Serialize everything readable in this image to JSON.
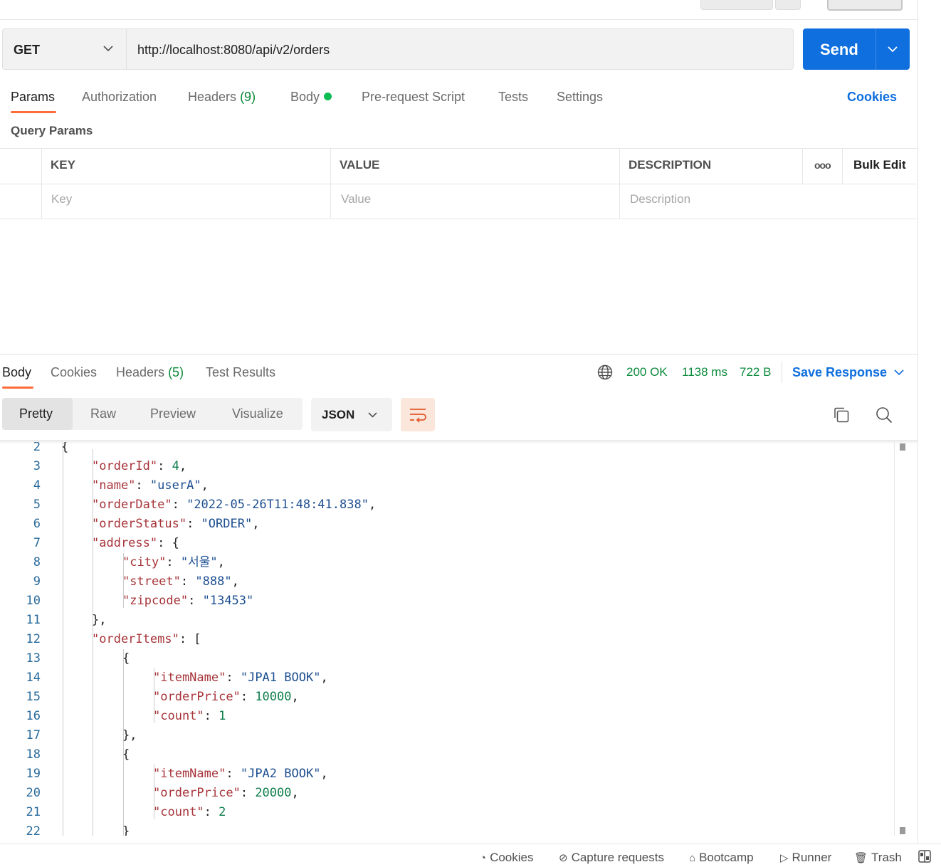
{
  "request": {
    "method": "GET",
    "url": "http://localhost:8080/api/v2/orders",
    "send_label": "Send"
  },
  "request_tabs": [
    {
      "label": "Params",
      "active": true
    },
    {
      "label": "Authorization"
    },
    {
      "label": "Headers",
      "count": "(9)"
    },
    {
      "label": "Body",
      "has_dot": true
    },
    {
      "label": "Pre-request Script"
    },
    {
      "label": "Tests"
    },
    {
      "label": "Settings"
    }
  ],
  "cookies_link": "Cookies",
  "query_params": {
    "title": "Query Params",
    "columns": {
      "key": "KEY",
      "value": "VALUE",
      "description": "DESCRIPTION"
    },
    "more_icon": "ooo",
    "bulk_edit": "Bulk Edit",
    "placeholders": {
      "key": "Key",
      "value": "Value",
      "description": "Description"
    }
  },
  "response": {
    "tabs": [
      {
        "label": "Body",
        "active": true
      },
      {
        "label": "Cookies"
      },
      {
        "label": "Headers",
        "count": "(5)"
      },
      {
        "label": "Test Results"
      }
    ],
    "status": "200 OK",
    "time": "1138 ms",
    "size": "722 B",
    "save_response": "Save Response",
    "view_modes": [
      "Pretty",
      "Raw",
      "Preview",
      "Visualize"
    ],
    "active_view": "Pretty",
    "format": "JSON"
  },
  "code_lines": [
    {
      "n": "2",
      "indent": 1,
      "tokens": [
        {
          "t": "{",
          "c": "p"
        }
      ]
    },
    {
      "n": "3",
      "indent": 2,
      "tokens": [
        {
          "t": "\"orderId\"",
          "c": "k"
        },
        {
          "t": ": ",
          "c": "p"
        },
        {
          "t": "4",
          "c": "n"
        },
        {
          "t": ",",
          "c": "p"
        }
      ]
    },
    {
      "n": "4",
      "indent": 2,
      "tokens": [
        {
          "t": "\"name\"",
          "c": "k"
        },
        {
          "t": ": ",
          "c": "p"
        },
        {
          "t": "\"userA\"",
          "c": "s"
        },
        {
          "t": ",",
          "c": "p"
        }
      ]
    },
    {
      "n": "5",
      "indent": 2,
      "tokens": [
        {
          "t": "\"orderDate\"",
          "c": "k"
        },
        {
          "t": ": ",
          "c": "p"
        },
        {
          "t": "\"2022-05-26T11:48:41.838\"",
          "c": "s"
        },
        {
          "t": ",",
          "c": "p"
        }
      ]
    },
    {
      "n": "6",
      "indent": 2,
      "tokens": [
        {
          "t": "\"orderStatus\"",
          "c": "k"
        },
        {
          "t": ": ",
          "c": "p"
        },
        {
          "t": "\"ORDER\"",
          "c": "s"
        },
        {
          "t": ",",
          "c": "p"
        }
      ]
    },
    {
      "n": "7",
      "indent": 2,
      "tokens": [
        {
          "t": "\"address\"",
          "c": "k"
        },
        {
          "t": ": {",
          "c": "p"
        }
      ]
    },
    {
      "n": "8",
      "indent": 3,
      "tokens": [
        {
          "t": "\"city\"",
          "c": "k"
        },
        {
          "t": ": ",
          "c": "p"
        },
        {
          "t": "\"서울\"",
          "c": "s"
        },
        {
          "t": ",",
          "c": "p"
        }
      ]
    },
    {
      "n": "9",
      "indent": 3,
      "tokens": [
        {
          "t": "\"street\"",
          "c": "k"
        },
        {
          "t": ": ",
          "c": "p"
        },
        {
          "t": "\"888\"",
          "c": "s"
        },
        {
          "t": ",",
          "c": "p"
        }
      ]
    },
    {
      "n": "10",
      "indent": 3,
      "tokens": [
        {
          "t": "\"zipcode\"",
          "c": "k"
        },
        {
          "t": ": ",
          "c": "p"
        },
        {
          "t": "\"13453\"",
          "c": "s"
        }
      ]
    },
    {
      "n": "11",
      "indent": 2,
      "tokens": [
        {
          "t": "},",
          "c": "p"
        }
      ]
    },
    {
      "n": "12",
      "indent": 2,
      "tokens": [
        {
          "t": "\"orderItems\"",
          "c": "k"
        },
        {
          "t": ": [",
          "c": "p"
        }
      ]
    },
    {
      "n": "13",
      "indent": 3,
      "tokens": [
        {
          "t": "{",
          "c": "p"
        }
      ]
    },
    {
      "n": "14",
      "indent": 4,
      "tokens": [
        {
          "t": "\"itemName\"",
          "c": "k"
        },
        {
          "t": ": ",
          "c": "p"
        },
        {
          "t": "\"JPA1 BOOK\"",
          "c": "s"
        },
        {
          "t": ",",
          "c": "p"
        }
      ]
    },
    {
      "n": "15",
      "indent": 4,
      "tokens": [
        {
          "t": "\"orderPrice\"",
          "c": "k"
        },
        {
          "t": ": ",
          "c": "p"
        },
        {
          "t": "10000",
          "c": "n"
        },
        {
          "t": ",",
          "c": "p"
        }
      ]
    },
    {
      "n": "16",
      "indent": 4,
      "tokens": [
        {
          "t": "\"count\"",
          "c": "k"
        },
        {
          "t": ": ",
          "c": "p"
        },
        {
          "t": "1",
          "c": "n"
        }
      ]
    },
    {
      "n": "17",
      "indent": 3,
      "tokens": [
        {
          "t": "},",
          "c": "p"
        }
      ]
    },
    {
      "n": "18",
      "indent": 3,
      "tokens": [
        {
          "t": "{",
          "c": "p"
        }
      ]
    },
    {
      "n": "19",
      "indent": 4,
      "tokens": [
        {
          "t": "\"itemName\"",
          "c": "k"
        },
        {
          "t": ": ",
          "c": "p"
        },
        {
          "t": "\"JPA2 BOOK\"",
          "c": "s"
        },
        {
          "t": ",",
          "c": "p"
        }
      ]
    },
    {
      "n": "20",
      "indent": 4,
      "tokens": [
        {
          "t": "\"orderPrice\"",
          "c": "k"
        },
        {
          "t": ": ",
          "c": "p"
        },
        {
          "t": "20000",
          "c": "n"
        },
        {
          "t": ",",
          "c": "p"
        }
      ]
    },
    {
      "n": "21",
      "indent": 4,
      "tokens": [
        {
          "t": "\"count\"",
          "c": "k"
        },
        {
          "t": ": ",
          "c": "p"
        },
        {
          "t": "2",
          "c": "n"
        }
      ]
    },
    {
      "n": "22",
      "indent": 3,
      "tokens": [
        {
          "t": "}",
          "c": "p"
        }
      ]
    }
  ],
  "footer": [
    {
      "label": "Cookies",
      "icon": "cookie-icon"
    },
    {
      "label": "Capture requests",
      "icon": "satellite-icon"
    },
    {
      "label": "Bootcamp",
      "icon": "graduation-cap-icon"
    },
    {
      "label": "Runner",
      "icon": "play-icon"
    },
    {
      "label": "Trash",
      "icon": "trash-icon"
    }
  ],
  "colors": {
    "accent_orange": "#ff6c37",
    "primary_blue": "#0f6fde",
    "status_green": "#0a8a3a",
    "json_key": "#a7353a",
    "json_string": "#1d4f91",
    "json_number": "#0e7d4b"
  }
}
